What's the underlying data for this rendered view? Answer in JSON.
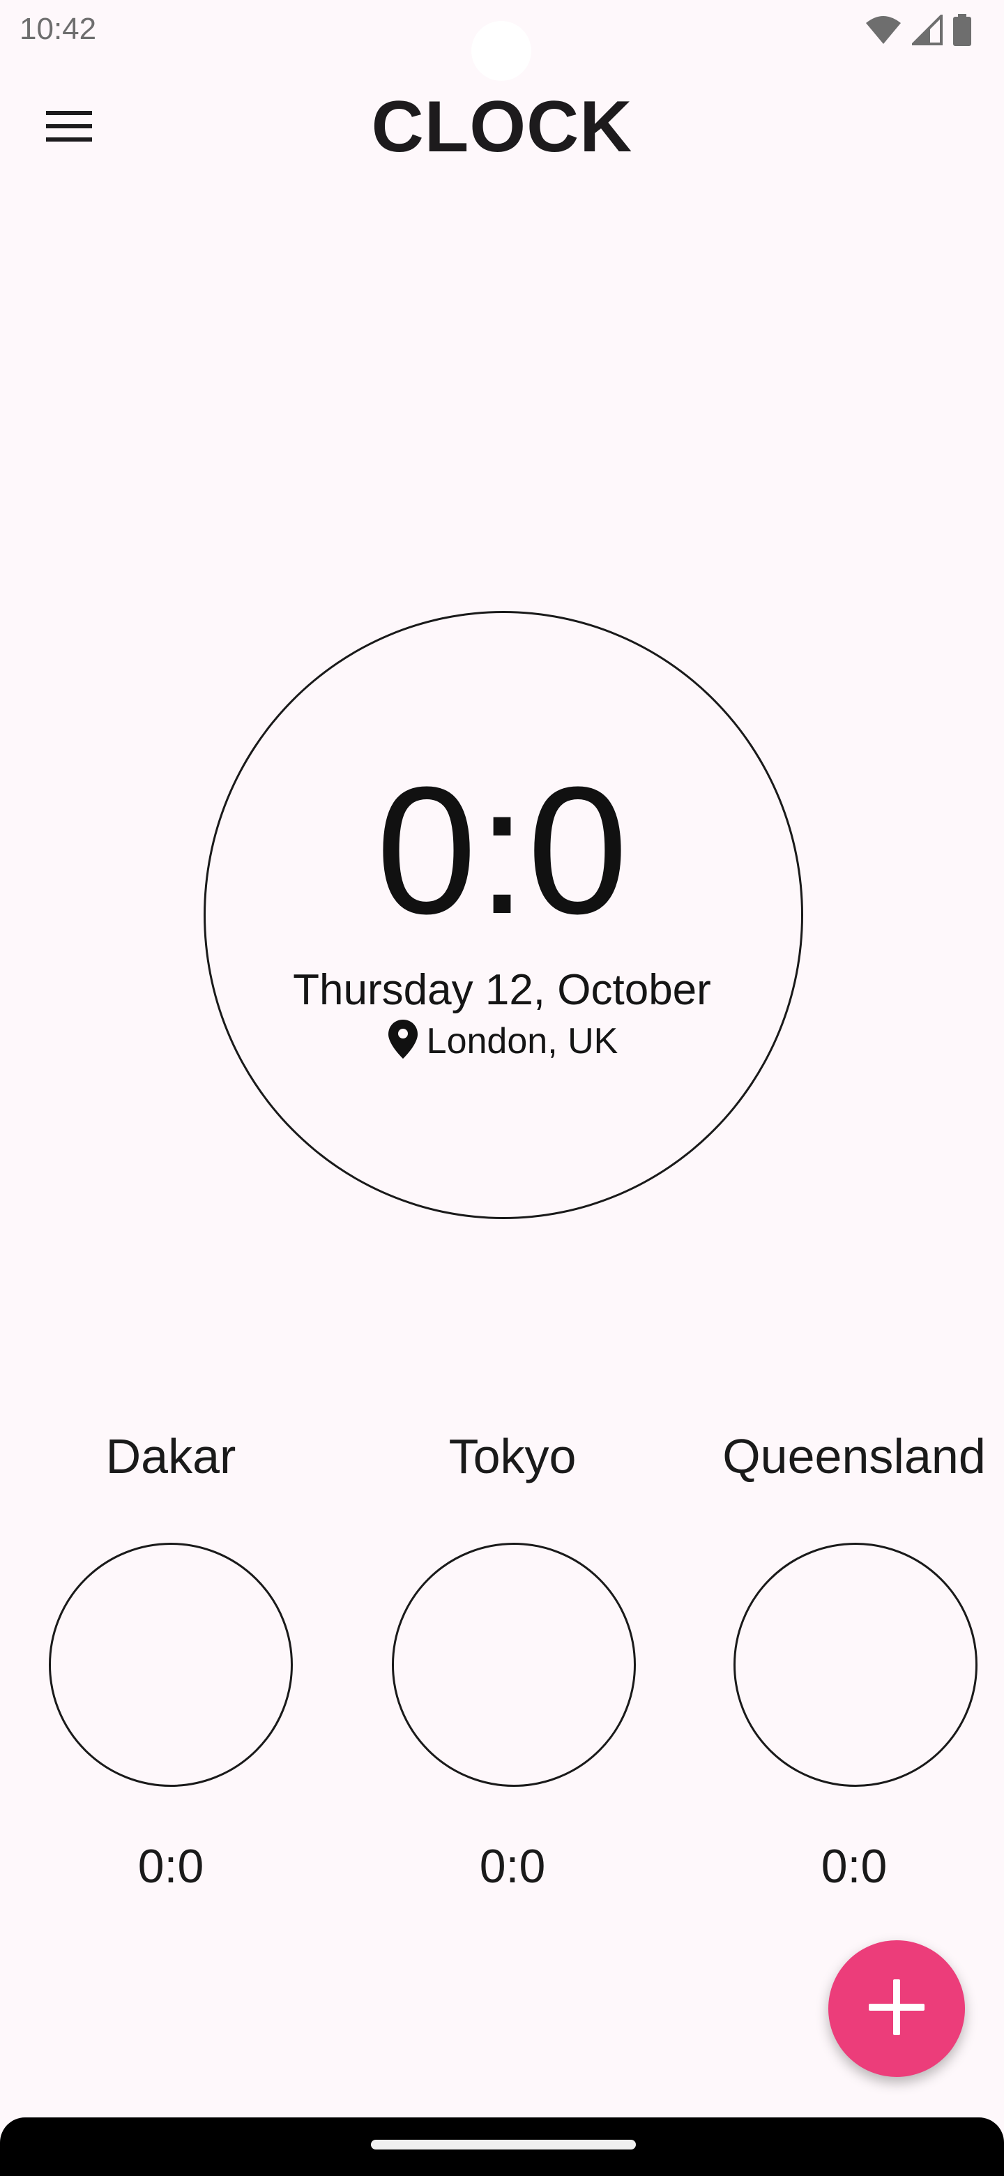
{
  "status_bar": {
    "time": "10:42",
    "icons": [
      "wifi-icon",
      "cellular-signal-icon",
      "battery-icon"
    ]
  },
  "app_bar": {
    "title": "CLOCK",
    "menu_icon": "hamburger-menu-icon"
  },
  "main_clock": {
    "time": "0:0",
    "date": "Thursday 12, October",
    "location": "London, UK",
    "location_icon": "location-pin-icon"
  },
  "world_clocks": [
    {
      "city": "Dakar",
      "time": "0:0"
    },
    {
      "city": "Tokyo",
      "time": "0:0"
    },
    {
      "city": "Queensland",
      "time": "0:0"
    }
  ],
  "fab": {
    "icon": "plus-icon",
    "color": "#EC3D7A"
  },
  "colors": {
    "background": "#FEF8FB",
    "accent": "#EC3D7A",
    "text": "#111111"
  }
}
